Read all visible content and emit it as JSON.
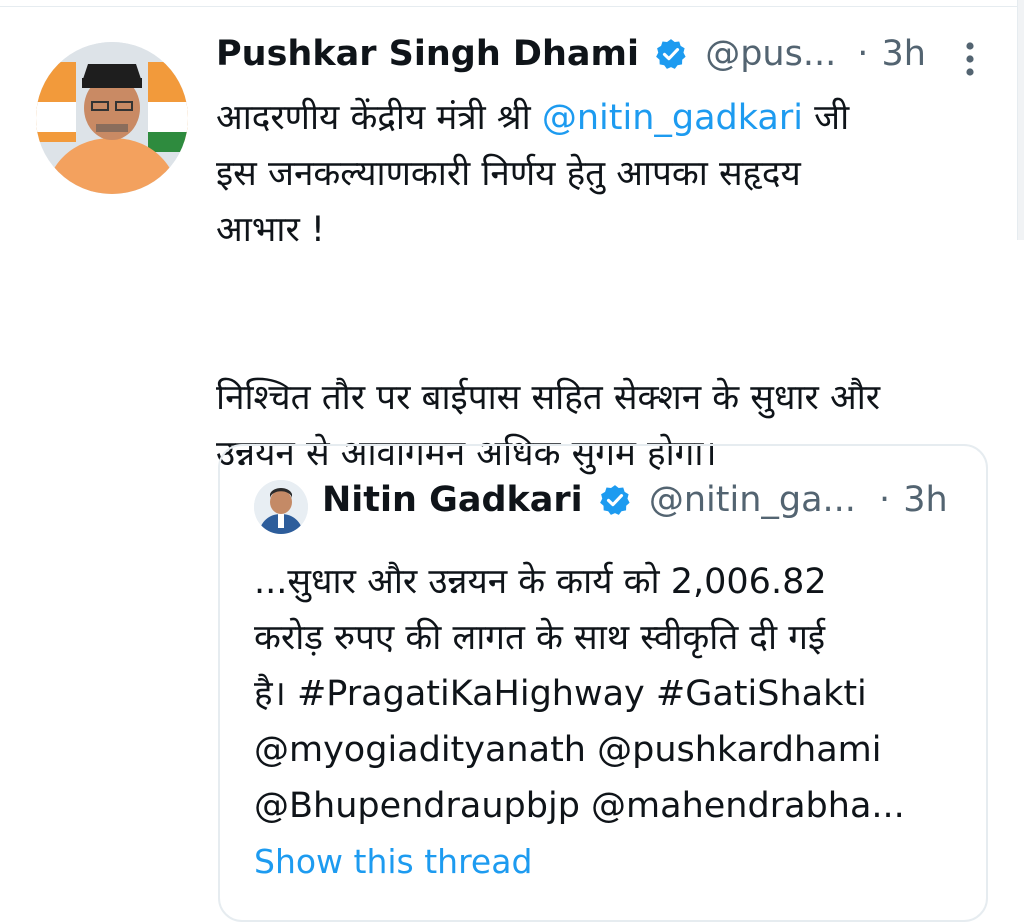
{
  "colors": {
    "accent": "#1d9bf0",
    "text": "#0f1419",
    "secondary": "#536471",
    "border": "#e6ecf0"
  },
  "tweet": {
    "author_name": "Pushkar Singh Dhami",
    "handle": "@pus...",
    "dot": "·",
    "time": "3h",
    "line1_prefix": "आदरणीय केंद्रीय मंत्री श्री ",
    "line1_mention": "@nitin_gadkari",
    "line1_suffix": " जी",
    "line2": "इस जनकल्याणकारी निर्णय हेतु आपका सहृदय",
    "line3": "आभार !",
    "line4": "निश्चित तौर पर बाईपास सहित सेक्शन के सुधार और",
    "line5": "उन्नयन से आवागमन अधिक सुगम होगा।",
    "icons": {
      "verified": "verified-badge-icon",
      "more": "more-vertical-icon"
    }
  },
  "quoted_tweet": {
    "author_name": "Nitin Gadkari",
    "handle": "@nitin_ga...",
    "dot": "·",
    "time": "3h",
    "line1": "...सुधार और उन्नयन के कार्य को 2,006.82",
    "line2": "करोड़ रुपए की लागत के साथ स्वीकृति दी गई",
    "line3": "है। #PragatiKaHighway #GatiShakti",
    "line4": "@myogiadityanath @pushkardhami",
    "line5": "@Bhupendraupbjp @mahendrabha...",
    "show_thread": "Show this thread"
  }
}
